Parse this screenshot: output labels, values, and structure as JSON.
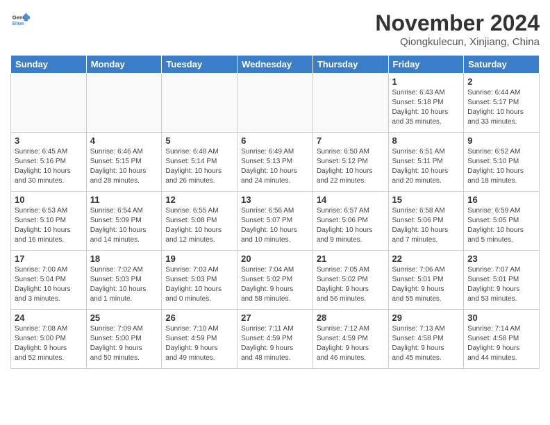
{
  "header": {
    "logo_line1": "General",
    "logo_line2": "Blue",
    "month_title": "November 2024",
    "location": "Qiongkulecun, Xinjiang, China"
  },
  "weekdays": [
    "Sunday",
    "Monday",
    "Tuesday",
    "Wednesday",
    "Thursday",
    "Friday",
    "Saturday"
  ],
  "weeks": [
    [
      {
        "day": "",
        "info": ""
      },
      {
        "day": "",
        "info": ""
      },
      {
        "day": "",
        "info": ""
      },
      {
        "day": "",
        "info": ""
      },
      {
        "day": "",
        "info": ""
      },
      {
        "day": "1",
        "info": "Sunrise: 6:43 AM\nSunset: 5:18 PM\nDaylight: 10 hours\nand 35 minutes."
      },
      {
        "day": "2",
        "info": "Sunrise: 6:44 AM\nSunset: 5:17 PM\nDaylight: 10 hours\nand 33 minutes."
      }
    ],
    [
      {
        "day": "3",
        "info": "Sunrise: 6:45 AM\nSunset: 5:16 PM\nDaylight: 10 hours\nand 30 minutes."
      },
      {
        "day": "4",
        "info": "Sunrise: 6:46 AM\nSunset: 5:15 PM\nDaylight: 10 hours\nand 28 minutes."
      },
      {
        "day": "5",
        "info": "Sunrise: 6:48 AM\nSunset: 5:14 PM\nDaylight: 10 hours\nand 26 minutes."
      },
      {
        "day": "6",
        "info": "Sunrise: 6:49 AM\nSunset: 5:13 PM\nDaylight: 10 hours\nand 24 minutes."
      },
      {
        "day": "7",
        "info": "Sunrise: 6:50 AM\nSunset: 5:12 PM\nDaylight: 10 hours\nand 22 minutes."
      },
      {
        "day": "8",
        "info": "Sunrise: 6:51 AM\nSunset: 5:11 PM\nDaylight: 10 hours\nand 20 minutes."
      },
      {
        "day": "9",
        "info": "Sunrise: 6:52 AM\nSunset: 5:10 PM\nDaylight: 10 hours\nand 18 minutes."
      }
    ],
    [
      {
        "day": "10",
        "info": "Sunrise: 6:53 AM\nSunset: 5:10 PM\nDaylight: 10 hours\nand 16 minutes."
      },
      {
        "day": "11",
        "info": "Sunrise: 6:54 AM\nSunset: 5:09 PM\nDaylight: 10 hours\nand 14 minutes."
      },
      {
        "day": "12",
        "info": "Sunrise: 6:55 AM\nSunset: 5:08 PM\nDaylight: 10 hours\nand 12 minutes."
      },
      {
        "day": "13",
        "info": "Sunrise: 6:56 AM\nSunset: 5:07 PM\nDaylight: 10 hours\nand 10 minutes."
      },
      {
        "day": "14",
        "info": "Sunrise: 6:57 AM\nSunset: 5:06 PM\nDaylight: 10 hours\nand 9 minutes."
      },
      {
        "day": "15",
        "info": "Sunrise: 6:58 AM\nSunset: 5:06 PM\nDaylight: 10 hours\nand 7 minutes."
      },
      {
        "day": "16",
        "info": "Sunrise: 6:59 AM\nSunset: 5:05 PM\nDaylight: 10 hours\nand 5 minutes."
      }
    ],
    [
      {
        "day": "17",
        "info": "Sunrise: 7:00 AM\nSunset: 5:04 PM\nDaylight: 10 hours\nand 3 minutes."
      },
      {
        "day": "18",
        "info": "Sunrise: 7:02 AM\nSunset: 5:03 PM\nDaylight: 10 hours\nand 1 minute."
      },
      {
        "day": "19",
        "info": "Sunrise: 7:03 AM\nSunset: 5:03 PM\nDaylight: 10 hours\nand 0 minutes."
      },
      {
        "day": "20",
        "info": "Sunrise: 7:04 AM\nSunset: 5:02 PM\nDaylight: 9 hours\nand 58 minutes."
      },
      {
        "day": "21",
        "info": "Sunrise: 7:05 AM\nSunset: 5:02 PM\nDaylight: 9 hours\nand 56 minutes."
      },
      {
        "day": "22",
        "info": "Sunrise: 7:06 AM\nSunset: 5:01 PM\nDaylight: 9 hours\nand 55 minutes."
      },
      {
        "day": "23",
        "info": "Sunrise: 7:07 AM\nSunset: 5:01 PM\nDaylight: 9 hours\nand 53 minutes."
      }
    ],
    [
      {
        "day": "24",
        "info": "Sunrise: 7:08 AM\nSunset: 5:00 PM\nDaylight: 9 hours\nand 52 minutes."
      },
      {
        "day": "25",
        "info": "Sunrise: 7:09 AM\nSunset: 5:00 PM\nDaylight: 9 hours\nand 50 minutes."
      },
      {
        "day": "26",
        "info": "Sunrise: 7:10 AM\nSunset: 4:59 PM\nDaylight: 9 hours\nand 49 minutes."
      },
      {
        "day": "27",
        "info": "Sunrise: 7:11 AM\nSunset: 4:59 PM\nDaylight: 9 hours\nand 48 minutes."
      },
      {
        "day": "28",
        "info": "Sunrise: 7:12 AM\nSunset: 4:59 PM\nDaylight: 9 hours\nand 46 minutes."
      },
      {
        "day": "29",
        "info": "Sunrise: 7:13 AM\nSunset: 4:58 PM\nDaylight: 9 hours\nand 45 minutes."
      },
      {
        "day": "30",
        "info": "Sunrise: 7:14 AM\nSunset: 4:58 PM\nDaylight: 9 hours\nand 44 minutes."
      }
    ]
  ]
}
